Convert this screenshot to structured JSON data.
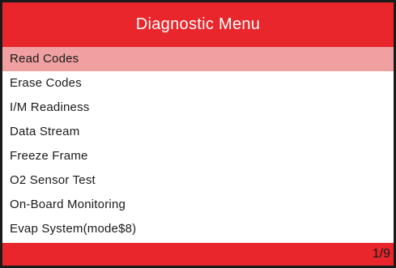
{
  "title": "Diagnostic Menu",
  "colors": {
    "title_bar": "#e8262b",
    "selected_row": "#f0a0a0",
    "footer_bar": "#e8262b",
    "frame": "#1a1a1a"
  },
  "menu": {
    "selected_index": 0,
    "items": [
      {
        "label": "Read Codes"
      },
      {
        "label": "Erase Codes"
      },
      {
        "label": "I/M Readiness"
      },
      {
        "label": "Data Stream"
      },
      {
        "label": "Freeze Frame"
      },
      {
        "label": "O2 Sensor Test"
      },
      {
        "label": "On-Board Monitoring"
      },
      {
        "label": "Evap System(mode$8)"
      }
    ]
  },
  "footer": {
    "page_indicator": "1/9"
  }
}
